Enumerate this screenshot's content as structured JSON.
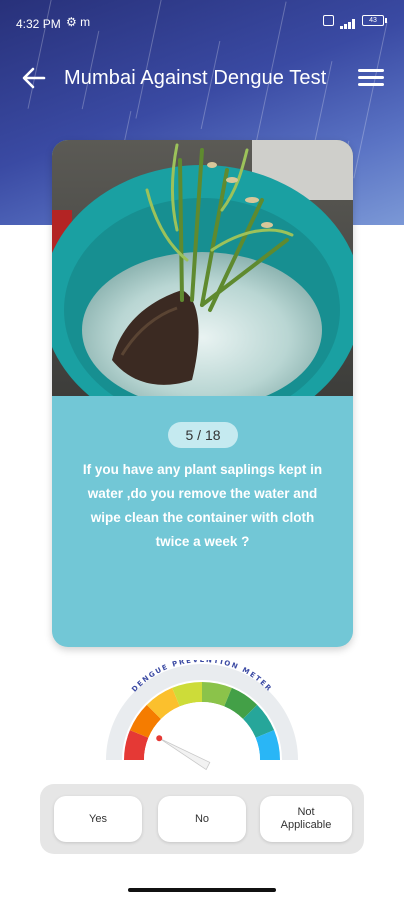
{
  "status_bar": {
    "time": "4:32 PM",
    "left_icons": "⚙ m",
    "battery": "43"
  },
  "header": {
    "title": "Mumbai Against Dengue Test",
    "back_icon": "arrow-left-icon",
    "menu_icon": "hamburger-menu-icon"
  },
  "question_card": {
    "counter": "5 / 18",
    "question": "If you have any plant saplings kept in water ,do you remove the water and wipe clean the container with cloth twice a week ?"
  },
  "meter": {
    "label": "DENGUE PREVENTION METER",
    "level": 0.15,
    "colors": [
      "#e53935",
      "#f57c00",
      "#fbc02d",
      "#cddc39",
      "#8bc34a",
      "#43a047",
      "#26a69a",
      "#29b6f6"
    ]
  },
  "answers": {
    "yes": "Yes",
    "no": "No",
    "na_line1": "Not",
    "na_line2": "Applicable"
  },
  "theme": {
    "header_blue": "#3a4aa3",
    "card_teal": "#72c7d6",
    "counter_bg": "#c5eaf0"
  }
}
